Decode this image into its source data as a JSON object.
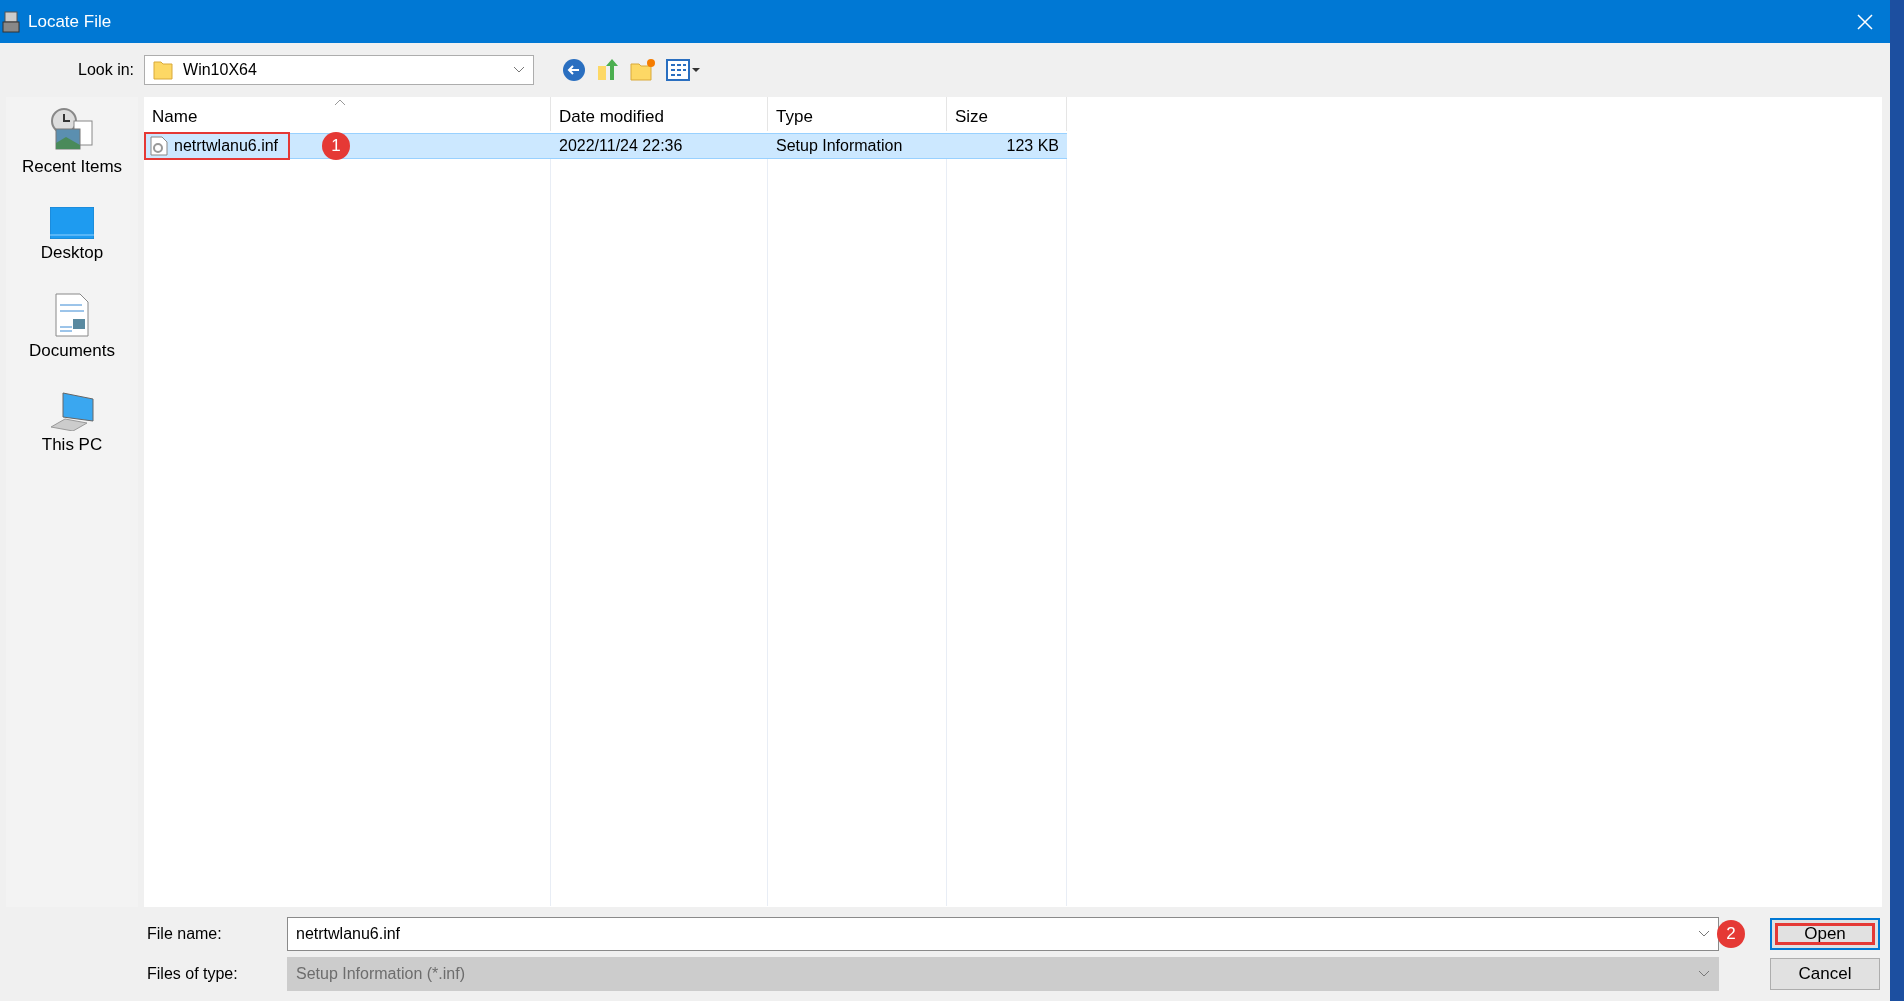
{
  "window": {
    "title": "Locate File"
  },
  "look_in": {
    "label": "Look in:",
    "value": "Win10X64"
  },
  "places": [
    {
      "kind": "recent",
      "label": "Recent Items"
    },
    {
      "kind": "desktop",
      "label": "Desktop"
    },
    {
      "kind": "documents",
      "label": "Documents"
    },
    {
      "kind": "pc",
      "label": "This PC"
    }
  ],
  "table": {
    "columns": [
      "Name",
      "Date modified",
      "Type",
      "Size"
    ],
    "rows": [
      {
        "cells": [
          "netrtwlanu6.inf",
          "2022/11/24 22:36",
          "Setup Information",
          "123 KB"
        ],
        "selected": true,
        "highlighted": true,
        "step": "1"
      }
    ]
  },
  "file_name": {
    "label": "File name:",
    "value": "netrtwlanu6.inf"
  },
  "file_type": {
    "label": "Files of type:",
    "value": "Setup Information (*.inf)",
    "disabled": true
  },
  "buttons": [
    {
      "label": "Open",
      "default": true,
      "highlighted": true,
      "step": "2"
    },
    {
      "label": "Cancel",
      "default": false,
      "highlighted": false
    }
  ]
}
